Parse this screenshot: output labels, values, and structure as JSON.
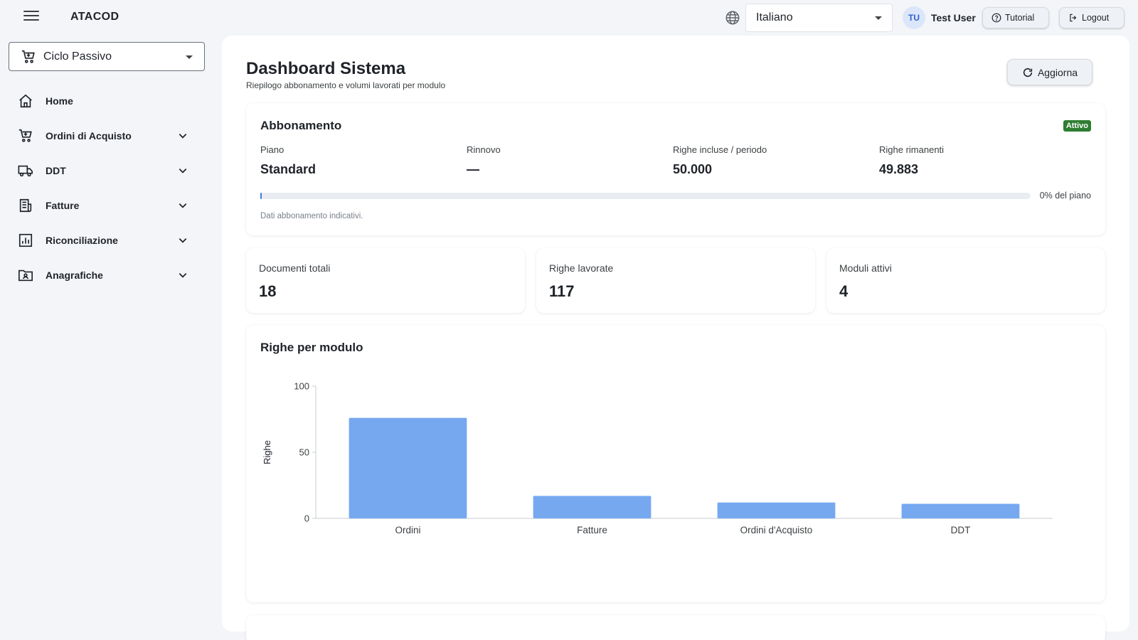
{
  "header": {
    "brand": "ATACOD",
    "language": "Italiano",
    "user_initials": "TU",
    "user_name": "Test User",
    "tutorial_label": "Tutorial",
    "logout_label": "Logout"
  },
  "sidebar": {
    "module": "Ciclo Passivo",
    "items": [
      {
        "label": "Home",
        "icon": "home-icon",
        "expandable": false
      },
      {
        "label": "Ordini di Acquisto",
        "icon": "cart-icon",
        "expandable": true
      },
      {
        "label": "DDT",
        "icon": "truck-icon",
        "expandable": true
      },
      {
        "label": "Fatture",
        "icon": "invoice-icon",
        "expandable": true
      },
      {
        "label": "Riconciliazione",
        "icon": "report-icon",
        "expandable": true
      },
      {
        "label": "Anagrafiche",
        "icon": "contact-folder-icon",
        "expandable": true
      }
    ]
  },
  "page": {
    "title": "Dashboard Sistema",
    "subtitle": "Riepilogo abbonamento e volumi lavorati per modulo",
    "refresh_label": "Aggiorna"
  },
  "subscription": {
    "title": "Abbonamento",
    "status": "Attivo",
    "plan_label": "Piano",
    "plan_value": "Standard",
    "renewal_label": "Rinnovo",
    "renewal_value": "—",
    "included_label": "Righe incluse / periodo",
    "included_value": "50.000",
    "remaining_label": "Righe rimanenti",
    "remaining_value": "49.883",
    "usage_fraction": 0.0023,
    "usage_label": "0% del piano",
    "note": "Dati abbonamento indicativi."
  },
  "stats": [
    {
      "label": "Documenti totali",
      "value": "18"
    },
    {
      "label": "Righe lavorate",
      "value": "117"
    },
    {
      "label": "Moduli attivi",
      "value": "4"
    }
  ],
  "colors": {
    "bar": "#76a8f0",
    "badge": "#2e7d32",
    "accent": "#3d7be8"
  },
  "chart_data": {
    "type": "bar",
    "title": "Righe per modulo",
    "ylabel": "Righe",
    "xlabel": "",
    "categories": [
      "Ordini",
      "Fatture",
      "Ordini d'Acquisto",
      "DDT"
    ],
    "values": [
      76,
      17,
      12,
      11
    ],
    "ylim": [
      0,
      100
    ],
    "yticks": [
      0,
      50,
      100
    ],
    "legend": false,
    "grid": false
  }
}
